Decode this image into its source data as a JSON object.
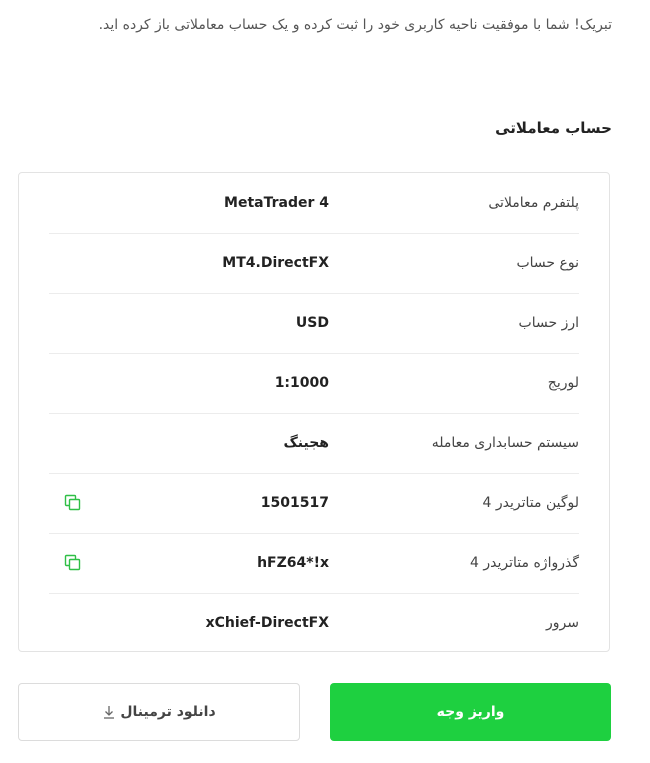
{
  "intro_text": "تبریک! شما با موفقیت ناحیه کاربری خود را ثبت کرده و یک حساب معاملاتی باز کرده اید.",
  "section_title": "حساب معاملاتی",
  "account_rows": [
    {
      "label": "پلتفرم معاملاتی",
      "value": "MetaTrader 4",
      "copyable": false
    },
    {
      "label": "نوع حساب",
      "value": "MT4.DirectFX",
      "copyable": false
    },
    {
      "label": "ارز حساب",
      "value": "USD",
      "copyable": false
    },
    {
      "label": "لوریج",
      "value": "1:1000",
      "copyable": false
    },
    {
      "label": "سیستم حسابداری معامله",
      "value": "هجینگ",
      "copyable": false
    },
    {
      "label": "لوگین متاتریدر 4",
      "value": "1501517",
      "copyable": true
    },
    {
      "label": "گذرواژه متاتریدر 4",
      "value": "hFZ64*!x",
      "copyable": true
    },
    {
      "label": "سرور",
      "value": "xChief-DirectFX",
      "copyable": false
    }
  ],
  "buttons": {
    "deposit_label": "واریز وجه",
    "download_label": "دانلود ترمینال"
  },
  "icons": {
    "copy": "copy-icon",
    "download": "download-arrow-icon"
  },
  "colors": {
    "accent": "#1ed040",
    "copy_icon": "#2fbf46"
  }
}
